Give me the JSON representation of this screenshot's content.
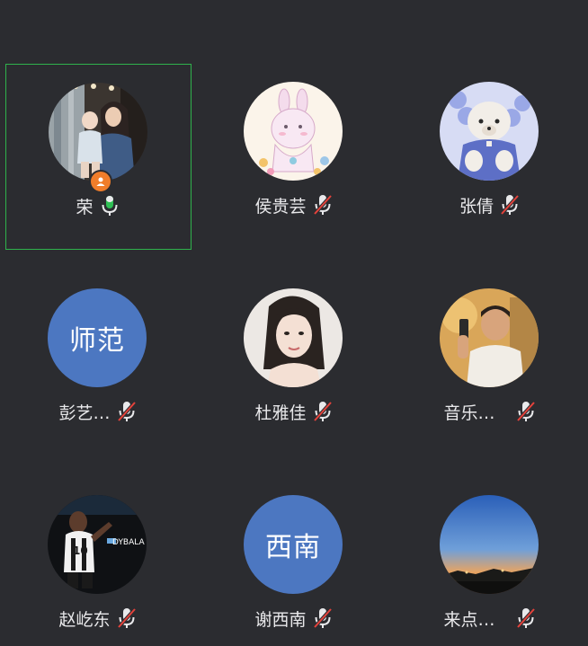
{
  "participants": [
    {
      "name": "荣",
      "mic": "on",
      "host": true,
      "active": true,
      "avatar_type": "photo",
      "avatar_desc": "mother-child-photo"
    },
    {
      "name": "侯贵芸",
      "mic": "muted",
      "avatar_type": "photo",
      "avatar_desc": "bunny-illustration"
    },
    {
      "name": "张倩",
      "mic": "muted",
      "avatar_type": "photo",
      "avatar_desc": "teddy-bear-photo"
    },
    {
      "name": "彭艺…",
      "mic": "muted",
      "avatar_type": "text",
      "avatar_text": "师范"
    },
    {
      "name": "杜雅佳",
      "mic": "muted",
      "avatar_type": "photo",
      "avatar_desc": "woman-portrait"
    },
    {
      "name": "音乐…",
      "mic": "muted",
      "avatar_type": "photo",
      "avatar_desc": "man-selfie"
    },
    {
      "name": "赵屹东",
      "mic": "muted",
      "avatar_type": "photo",
      "avatar_desc": "football-player",
      "avatar_caption": "DYBALA"
    },
    {
      "name": "谢西南",
      "mic": "muted",
      "avatar_type": "text",
      "avatar_text": "西南"
    },
    {
      "name": "来点…",
      "mic": "muted",
      "avatar_type": "photo",
      "avatar_desc": "sunset-sky"
    }
  ],
  "colors": {
    "background": "#2b2c30",
    "active_border": "#2fb24c",
    "mic_on": "#2fbf54",
    "mic_muted_slash": "#e5423b",
    "text_avatar": "#4c77c1",
    "host_badge": "#f07d2a"
  }
}
